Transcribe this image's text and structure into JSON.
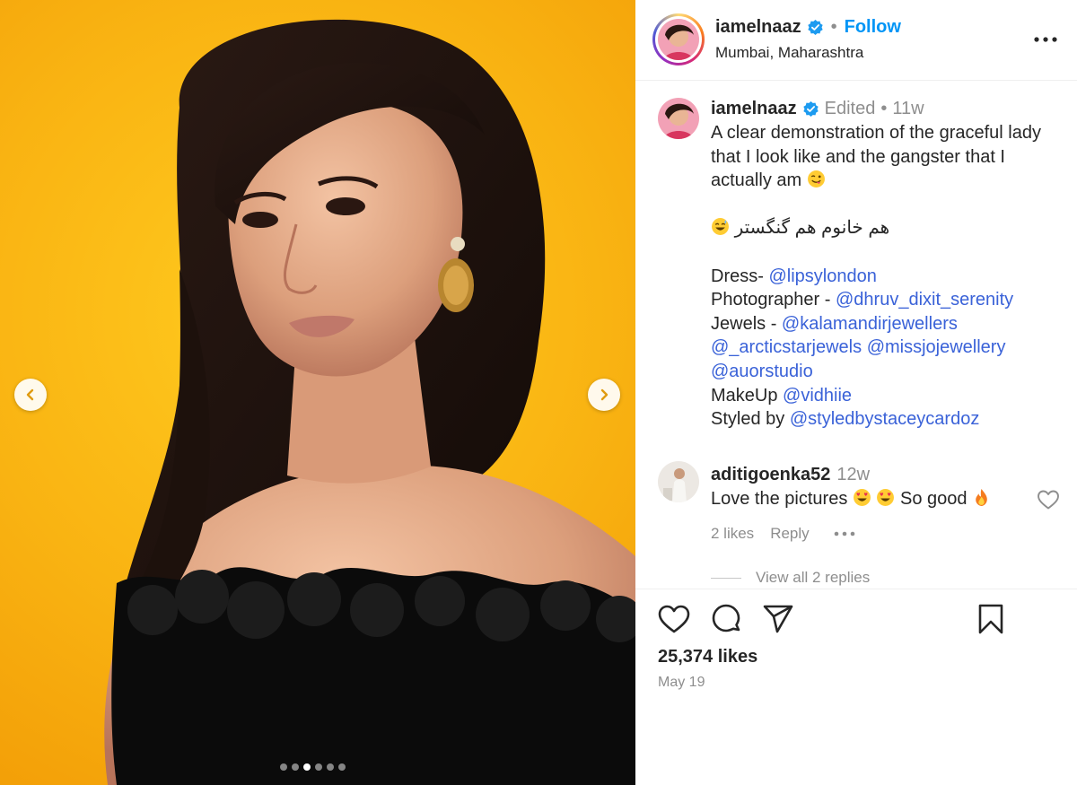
{
  "post": {
    "username": "iamelnaaz",
    "follow_label": "Follow",
    "location": "Mumbai, Maharashtra",
    "carousel": {
      "total_slides": 6,
      "active_slide": 3
    }
  },
  "caption": {
    "username": "iamelnaaz",
    "edited_label": "Edited",
    "age": "11w",
    "line1": "A clear demonstration of the graceful lady that I look like and the gangster that I actually am",
    "urdu": "هم خانوم هم گنگستر",
    "dress_label": "Dress-",
    "dress_handle": "@lipsylondon",
    "photographer_label": "Photographer -",
    "photographer_handle": "@dhruv_dixit_serenity",
    "jewels_label": "Jewels -",
    "jewels_handle_1": "@kalamandirjewellers",
    "jewels_handle_2": "@_arcticstarjewels",
    "jewels_handle_3": "@missjojewellery",
    "jewels_handle_4": "@auorstudio",
    "makeup_label": "MakeUp",
    "makeup_handle": "@vidhiie",
    "styled_label": "Styled by",
    "styled_handle": "@styledbystaceycardoz"
  },
  "comment": {
    "username": "aditigoenka52",
    "age": "12w",
    "text_part1": "Love the pictures",
    "text_part2": "So good",
    "likes_label": "2 likes",
    "reply_label": "Reply",
    "view_replies_label": "View all 2 replies"
  },
  "footer": {
    "likes_count": "25,374 likes",
    "date": "May 19"
  },
  "colors": {
    "accent_blue": "#0095f6",
    "mention_blue": "#3a62d8",
    "verified_blue": "#1d9bf0",
    "muted_gray": "#8e8e8e",
    "backdrop_yellow": "#f9b312"
  },
  "icons": {
    "prev": "chevron-left-icon",
    "next": "chevron-right-icon",
    "more": "more-horizontal-icon",
    "like": "heart-icon",
    "comment": "comment-icon",
    "share": "paper-plane-icon",
    "save": "bookmark-icon"
  }
}
